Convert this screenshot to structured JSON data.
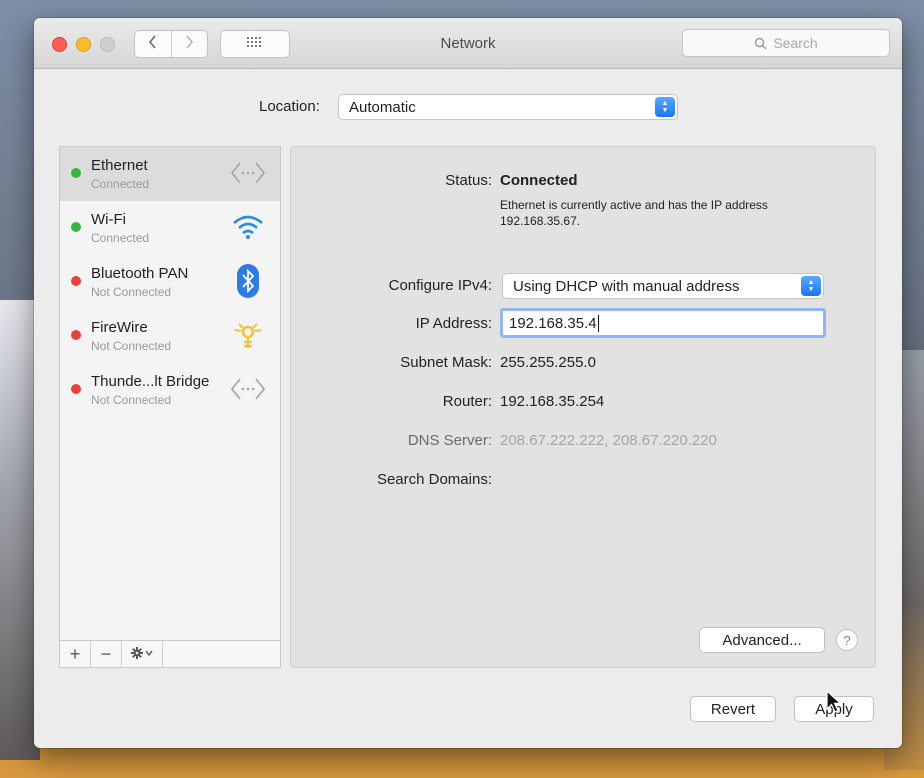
{
  "window": {
    "title": "Network",
    "search_placeholder": "Search",
    "nav": {
      "back_icon": "chevron-left-icon",
      "forward_icon": "chevron-right-icon",
      "show_all_icon": "grid-icon"
    }
  },
  "location": {
    "label": "Location:",
    "value": "Automatic"
  },
  "services": [
    {
      "name": "Ethernet",
      "status": "Connected",
      "status_color": "#3fb33f",
      "icon": "ethernet-arrows-icon",
      "selected": true
    },
    {
      "name": "Wi-Fi",
      "status": "Connected",
      "status_color": "#3fb33f",
      "icon": "wifi-icon",
      "selected": false
    },
    {
      "name": "Bluetooth PAN",
      "status": "Not Connected",
      "status_color": "#e8413d",
      "icon": "bluetooth-icon",
      "selected": false
    },
    {
      "name": "FireWire",
      "status": "Not Connected",
      "status_color": "#e8413d",
      "icon": "firewire-icon",
      "selected": false
    },
    {
      "name": "Thunde...lt Bridge",
      "status": "Not Connected",
      "status_color": "#e8413d",
      "icon": "ethernet-arrows-icon",
      "selected": false
    }
  ],
  "sidebar_controls": {
    "add": "+",
    "remove": "−"
  },
  "detail": {
    "status_label": "Status:",
    "status_value": "Connected",
    "status_desc": "Ethernet is currently active and has the IP address 192.168.35.67.",
    "configure_label": "Configure IPv4:",
    "configure_value": "Using DHCP with manual address",
    "ip_label": "IP Address:",
    "ip_value": "192.168.35.4",
    "subnet_label": "Subnet Mask:",
    "subnet_value": "255.255.255.0",
    "router_label": "Router:",
    "router_value": "192.168.35.254",
    "dns_label": "DNS Server:",
    "dns_value": "208.67.222.222, 208.67.220.220",
    "search_domains_label": "Search Domains:",
    "advanced_label": "Advanced...",
    "help_label": "?"
  },
  "footer": {
    "revert_label": "Revert",
    "apply_label": "Apply"
  },
  "colors": {
    "accent": "#1877ee",
    "connected": "#3fb33f",
    "disconnected": "#e8413d",
    "bluetooth": "#2f7be0",
    "firewire": "#f2c23a"
  }
}
